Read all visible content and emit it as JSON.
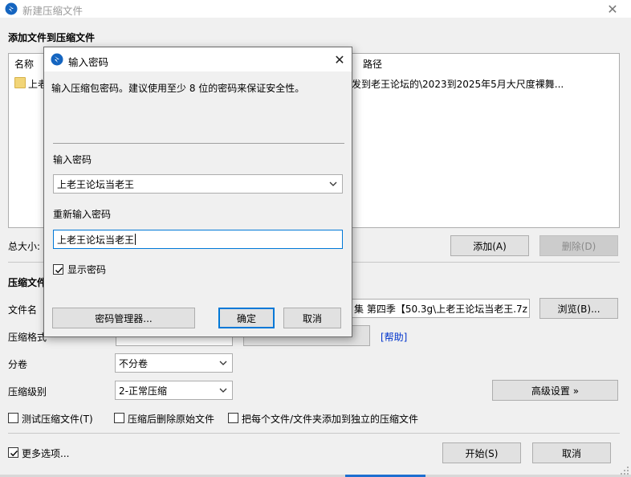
{
  "main_window": {
    "title": "新建压缩文件",
    "close_glyph": "✕"
  },
  "add_files": {
    "heading": "添加文件到压缩文件",
    "columns": {
      "name": "名称",
      "path": "路径"
    },
    "rows": [
      {
        "name_fragment": "上老",
        "path_fragment": "发到老王论坛的\\2023到2025年5月大尺度裸舞..."
      }
    ],
    "total_size_label": "总大小:",
    "add_button": "添加(A)",
    "delete_button": "删除(D)"
  },
  "compress": {
    "heading_fragment": "压缩文件",
    "filename_label": "文件名",
    "filename_value": "集 第四季【50.3g\\上老王论坛当老王.7z",
    "browse_button": "浏览(B)...",
    "format_label_fragment": "压缩格式",
    "help_link": "[帮助]",
    "split_label": "分卷",
    "split_value": "不分卷",
    "level_label": "压缩级别",
    "level_value": "2-正常压缩",
    "advanced_button": "高级设置 »",
    "test_checkbox": "测试压缩文件(T)",
    "delete_after_checkbox": "压缩后删除原始文件",
    "each_file_checkbox": "把每个文件/文件夹添加到独立的压缩文件",
    "more_options_checkbox": "更多选项...",
    "start_button": "开始(S)",
    "cancel_button": "取消"
  },
  "dialog": {
    "title": "输入密码",
    "close_glyph": "✕",
    "description": "输入压缩包密码。建议使用至少 8 位的密码来保证安全性。",
    "password_label": "输入密码",
    "password_value": "上老王论坛当老王",
    "reenter_label": "重新输入密码",
    "reenter_value": "上老王论坛当老王",
    "show_password_label": "显示密码",
    "show_password_checked": true,
    "manager_button": "密码管理器...",
    "ok_button": "确定",
    "cancel_button": "取消"
  },
  "colors": {
    "accent": "#0078d7",
    "link": "#0033cc",
    "app_icon": "#1565c0"
  }
}
